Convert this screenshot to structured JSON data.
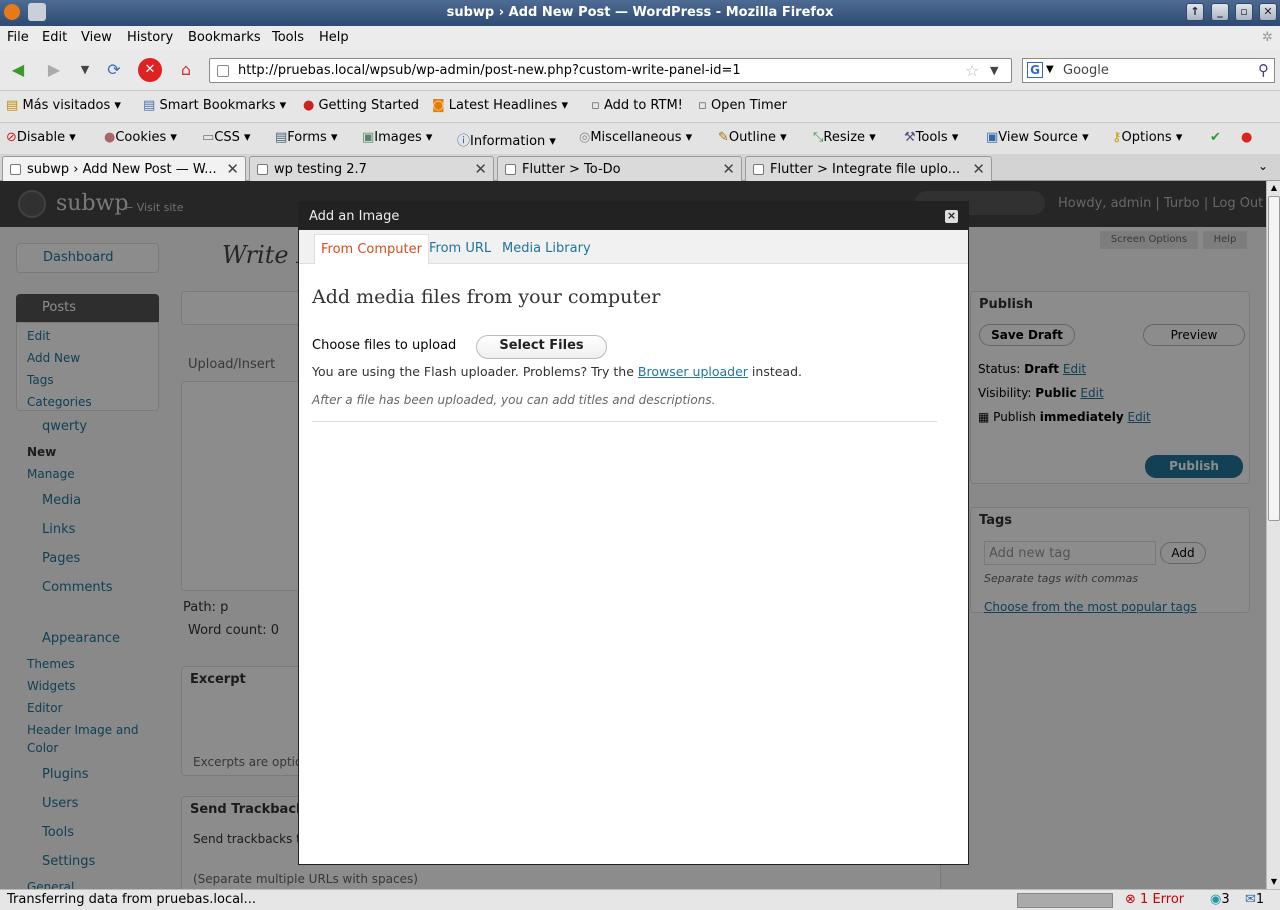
{
  "window": {
    "title": "subwp › Add New Post — WordPress - Mozilla Firefox"
  },
  "menu": [
    "File",
    "Edit",
    "View",
    "History",
    "Bookmarks",
    "Tools",
    "Help"
  ],
  "nav": {
    "url": "http://pruebas.local/wpsub/wp-admin/post-new.php?custom-write-panel-id=1",
    "search_placeholder": "Google"
  },
  "bookmarks": [
    "Más visitados",
    "Smart Bookmarks",
    "Getting Started",
    "Latest Headlines",
    "Add to RTM!",
    "Open Timer"
  ],
  "devtoolbar": [
    "Disable",
    "Cookies",
    "CSS",
    "Forms",
    "Images",
    "Information",
    "Miscellaneous",
    "Outline",
    "Resize",
    "Tools",
    "View Source",
    "Options"
  ],
  "tabs": [
    {
      "label": "subwp › Add New Post — W..."
    },
    {
      "label": "wp testing 2.7"
    },
    {
      "label": "Flutter > To-Do"
    },
    {
      "label": "Flutter > Integrate file uplo..."
    }
  ],
  "wp": {
    "site": "subwp",
    "visit_site": "← Visit site",
    "howdy": "Howdy, admin | Turbo | Log Out",
    "page_title": "Write P",
    "screen_options": "Screen Options",
    "help": "Help",
    "menu": {
      "dashboard": "Dashboard",
      "posts": "Posts",
      "posts_sub": [
        "Edit",
        "Add New",
        "Tags",
        "Categories"
      ],
      "qwerty": "qwerty",
      "qwerty_sub": [
        "New",
        "Manage"
      ],
      "media": "Media",
      "links": "Links",
      "pages": "Pages",
      "comments": "Comments",
      "appearance": "Appearance",
      "appearance_sub": [
        "Themes",
        "Widgets",
        "Editor",
        "Header Image and",
        "Color"
      ],
      "plugins": "Plugins",
      "users": "Users",
      "tools": "Tools",
      "settings": "Settings",
      "settings_sub": "General"
    },
    "editor": {
      "upload_insert": "Upload/Insert",
      "path": "Path: p",
      "word_count": "Word count: 0"
    },
    "excerpt": {
      "title": "Excerpt",
      "hint": "Excerpts are optio"
    },
    "trackbacks": {
      "title": "Send Trackbacks",
      "label": "Send trackbacks to",
      "hint": "(Separate multiple URLs with spaces)"
    },
    "publish": {
      "title": "Publish",
      "save_draft": "Save Draft",
      "preview": "Preview",
      "status_label": "Status:",
      "status_value": "Draft",
      "visibility_label": "Visibility:",
      "visibility_value": "Public",
      "publish_label": "Publish",
      "publish_value": "immediately",
      "edit": "Edit",
      "publish_button": "Publish"
    },
    "tags": {
      "title": "Tags",
      "placeholder": "Add new tag",
      "add": "Add",
      "hint": "Separate tags with commas",
      "popular": "Choose from the most popular tags"
    }
  },
  "modal": {
    "title": "Add an Image",
    "tabs": [
      "From Computer",
      "From URL",
      "Media Library"
    ],
    "heading": "Add media files from your computer",
    "choose_label": "Choose files to upload",
    "select_files": "Select Files",
    "flash_text": "You are using the Flash uploader. Problems? Try the",
    "browser_uploader": "Browser uploader",
    "instead": "instead.",
    "after_upload": "After a file has been uploaded, you can add titles and descriptions."
  },
  "status": {
    "text": "Transferring data from pruebas.local...",
    "errors": "1 Error",
    "twitter": "3",
    "mail": "1"
  },
  "colors": {
    "accent": "#21759b",
    "active_tab": "#d54e21",
    "publish": "#21759b"
  }
}
